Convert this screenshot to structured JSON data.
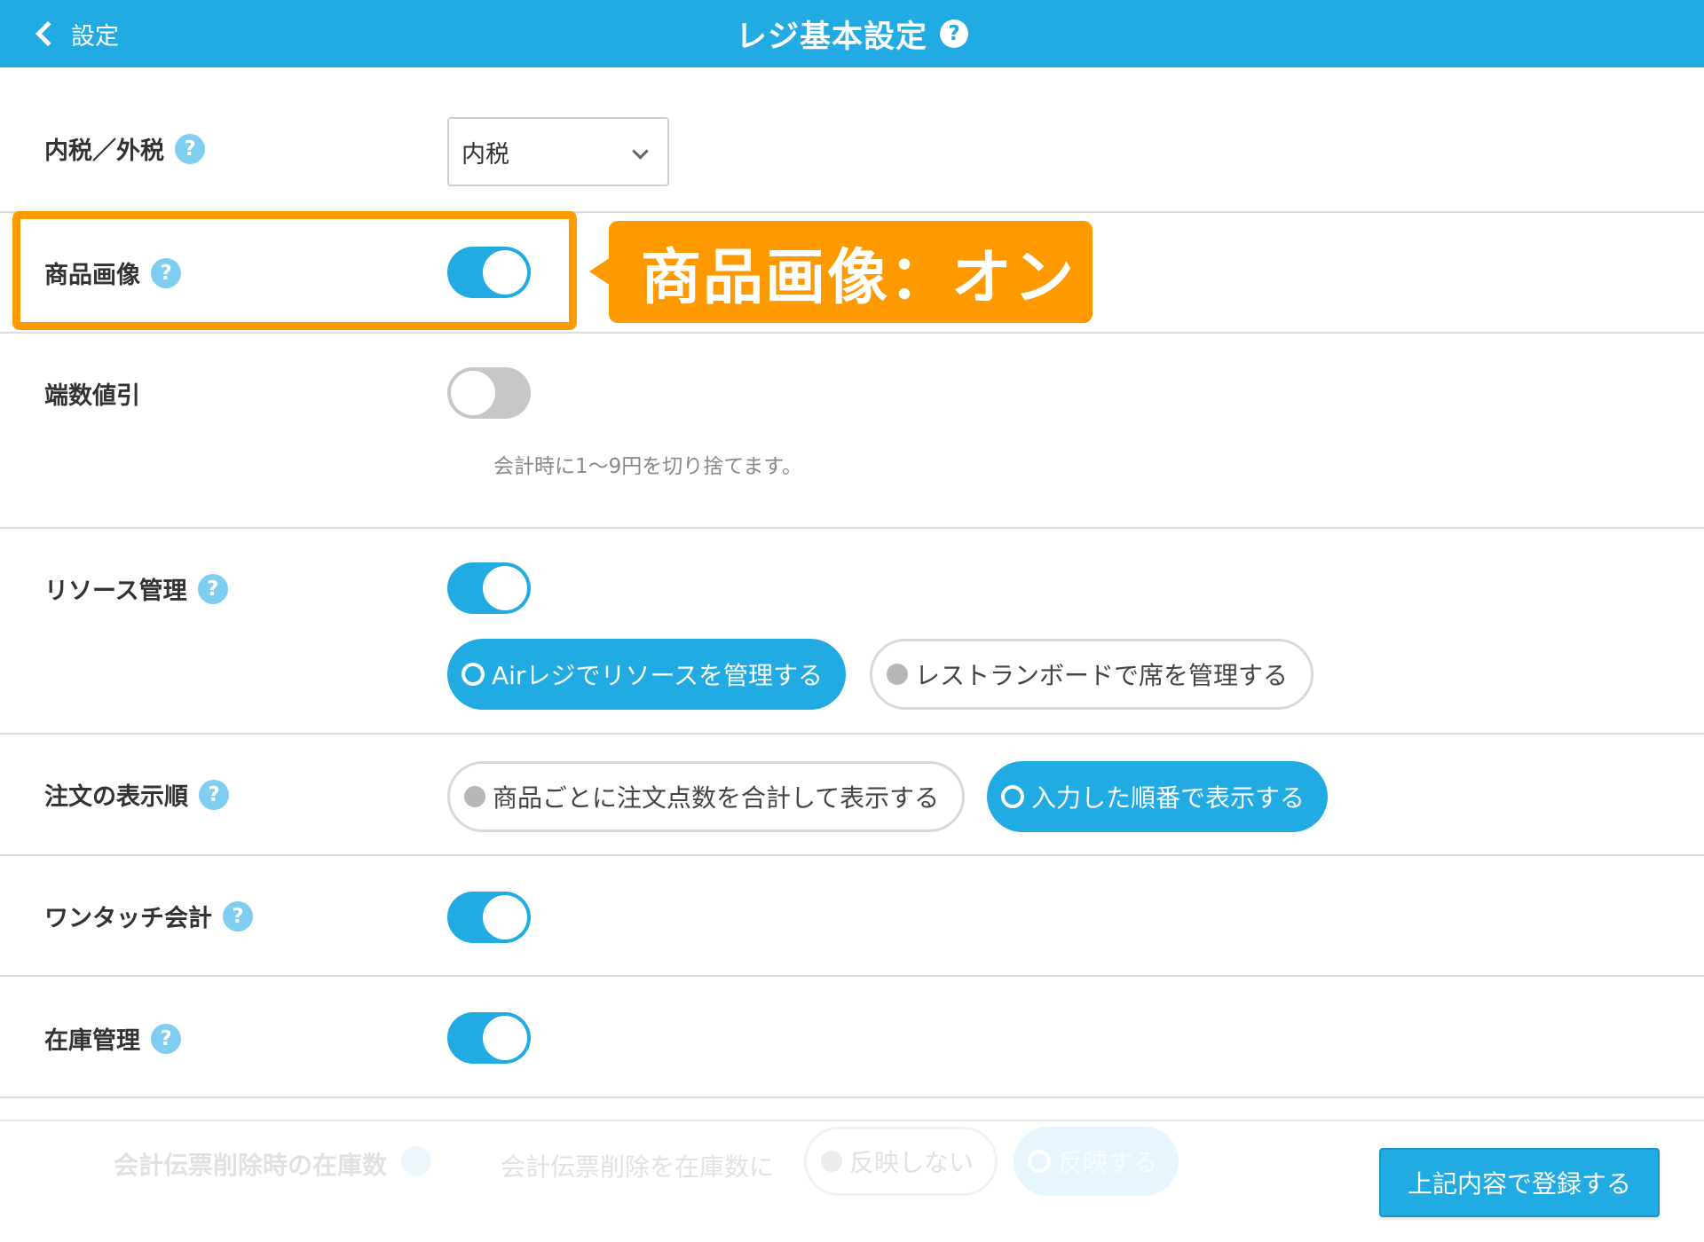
{
  "header": {
    "back_label": "設定",
    "title": "レジ基本設定",
    "help_glyph": "?",
    "background_color": "#21ABE2"
  },
  "settings": {
    "tax": {
      "label": "内税／外税",
      "help_glyph": "?",
      "selected_value": "内税"
    },
    "product_image": {
      "label": "商品画像",
      "help_glyph": "?",
      "toggle_on": true
    },
    "rounding_discount": {
      "label": "端数値引",
      "toggle_on": false,
      "note": "会計時に1〜9円を切り捨てます。"
    },
    "resource_management": {
      "label": "リソース管理",
      "help_glyph": "?",
      "toggle_on": true,
      "options": [
        {
          "label": "Airレジでリソースを管理する",
          "selected": true
        },
        {
          "label": "レストランボードで席を管理する",
          "selected": false
        }
      ]
    },
    "order_display": {
      "label": "注文の表示順",
      "help_glyph": "?",
      "options": [
        {
          "label": "商品ごとに注文点数を合計して表示する",
          "selected": false
        },
        {
          "label": "入力した順番で表示する",
          "selected": true
        }
      ]
    },
    "one_touch": {
      "label": "ワンタッチ会計",
      "help_glyph": "?",
      "toggle_on": true
    },
    "inventory": {
      "label": "在庫管理",
      "help_glyph": "?",
      "toggle_on": true
    }
  },
  "annotation": {
    "text": "商品画像：オン",
    "color": "#FF9900"
  },
  "footer": {
    "faded_label": "会計伝票削除時の在庫数",
    "faded_help_glyph": "?",
    "faded_desc": "会計伝票削除を在庫数に",
    "faded_options": [
      {
        "label": "反映しない",
        "selected": false
      },
      {
        "label": "反映する",
        "selected": true
      }
    ],
    "submit_label": "上記内容で登録する"
  }
}
